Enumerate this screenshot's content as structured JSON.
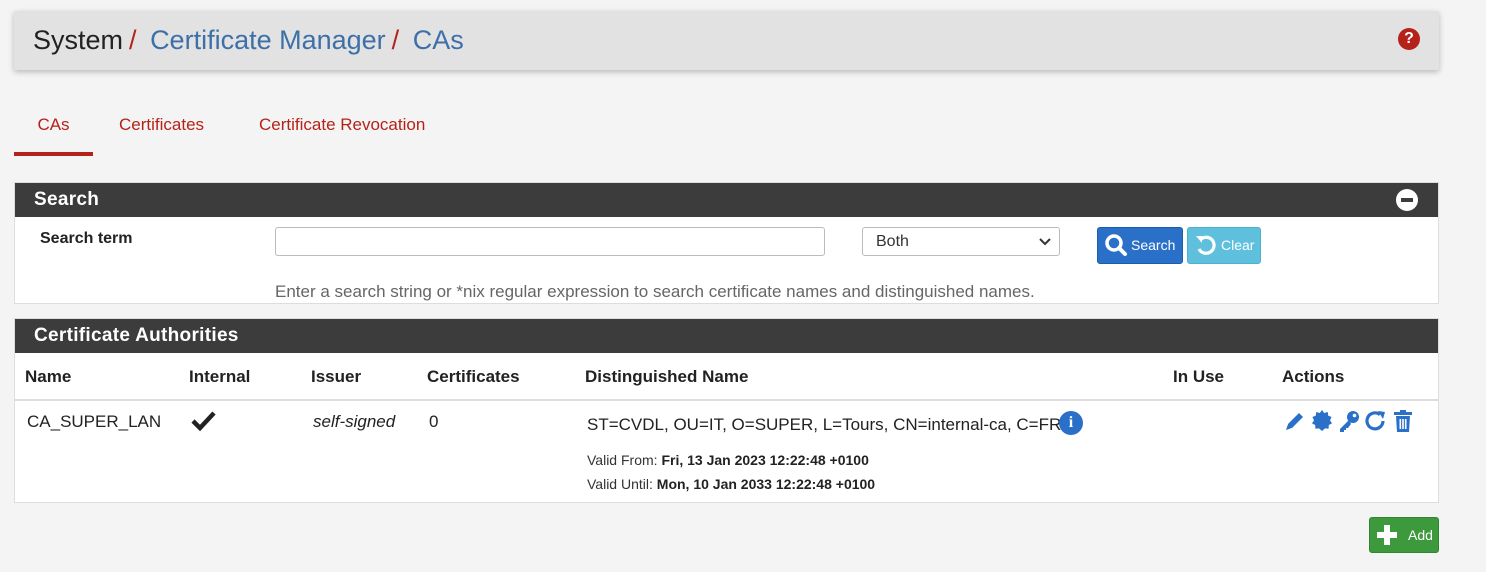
{
  "breadcrumb": {
    "system": "System",
    "sep1": "/",
    "cert_manager": "Certificate Manager",
    "sep2": "/",
    "current": "CAs"
  },
  "help_icon": "?",
  "tabs": [
    {
      "label": "CAs",
      "active": true
    },
    {
      "label": "Certificates",
      "active": false
    },
    {
      "label": "Certificate Revocation",
      "active": false
    }
  ],
  "search_panel": {
    "title": "Search",
    "label": "Search term",
    "input_value": "",
    "select_value": "Both",
    "search_button": "Search",
    "clear_button": "Clear",
    "hint": "Enter a search string or *nix regular expression to search certificate names and distinguished names."
  },
  "ca_panel": {
    "title": "Certificate Authorities",
    "columns": [
      "Name",
      "Internal",
      "Issuer",
      "Certificates",
      "Distinguished Name",
      "In Use",
      "Actions"
    ],
    "rows": [
      {
        "name": "CA_SUPER_LAN",
        "internal": true,
        "issuer": "self-signed",
        "certificates": "0",
        "dn": "ST=CVDL, OU=IT, O=SUPER, L=Tours, CN=internal-ca, C=FR",
        "valid_from_label": "Valid From:",
        "valid_from": "Fri, 13 Jan 2023 12:22:48 +0100",
        "valid_until_label": "Valid Until:",
        "valid_until": "Mon, 10 Jan 2033 12:22:48 +0100",
        "in_use": ""
      }
    ]
  },
  "add_button": "Add",
  "colors": {
    "accent_red": "#b5221a",
    "link_blue": "#3d6fa8",
    "panel_dark": "#3c3c3c",
    "btn_primary": "#2a70c9",
    "btn_info": "#5fc0de",
    "btn_success": "#3c9a3c"
  },
  "icons": {
    "help": "question-circle-icon",
    "collapse": "minus-circle-icon",
    "search": "search-icon",
    "clear": "undo-icon",
    "internal": "check-icon",
    "dn_info": "info-circle-icon",
    "actions": [
      "pencil-icon",
      "certificate-icon",
      "key-icon",
      "refresh-icon",
      "trash-icon"
    ],
    "add": "plus-icon"
  }
}
